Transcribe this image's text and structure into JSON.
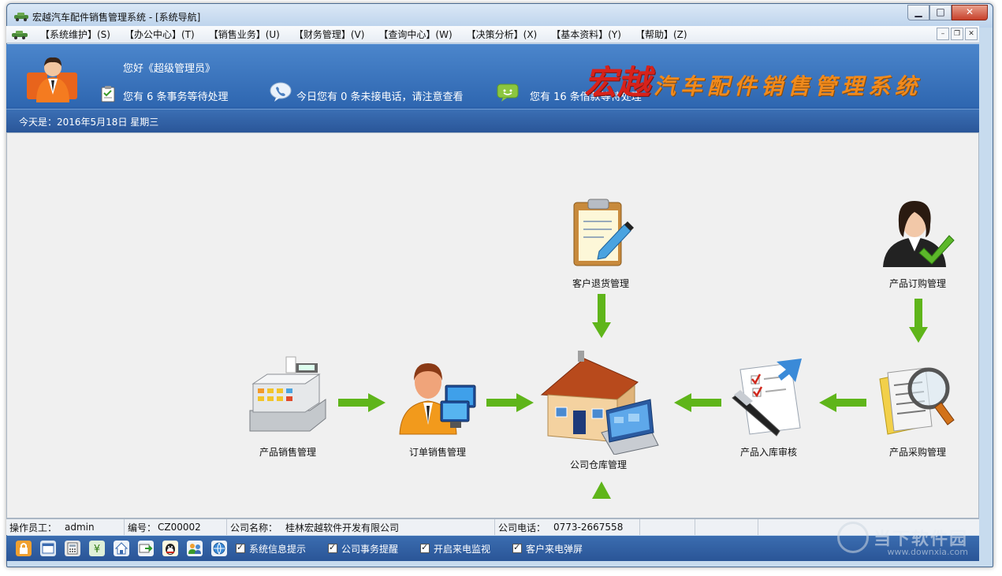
{
  "window": {
    "title": "宏越汽车配件销售管理系统 - [系统导航]"
  },
  "menubar": {
    "items": [
      "【系统维护】(S)",
      "【办公中心】(T)",
      "【销售业务】(U)",
      "【财务管理】(V)",
      "【查询中心】(W)",
      "【决策分析】(X)",
      "【基本资料】(Y)",
      "【帮助】(Z)"
    ]
  },
  "banner": {
    "greeting": "您好《超级管理员》",
    "tasks_text": "您有 6 条事务等待处理",
    "calls_text": "今日您有 0 条未接电话，请注意查看",
    "loans_text": "您有 16 条借款等待处理",
    "brand_big": "宏越",
    "brand_rest": "汽车配件销售管理系统",
    "date_text": "今天是：2016年5月18日   星期三"
  },
  "nav": {
    "customer_return": "客户退货管理",
    "product_order": "产品订购管理",
    "product_sales": "产品销售管理",
    "order_sales": "订单销售管理",
    "warehouse": "公司仓库管理",
    "stock_in_audit": "产品入库审核",
    "product_purchase": "产品采购管理"
  },
  "statusbar": {
    "operator_label": "操作员工：",
    "operator_value": "admin",
    "id_label": "编号：",
    "id_value": "CZ00002",
    "company_label": "公司名称：",
    "company_value": "桂林宏越软件开发有限公司",
    "phone_label": "公司电话：",
    "phone_value": "0773-2667558"
  },
  "toolbar": {
    "checkboxes": [
      "系统信息提示",
      "公司事务提醒",
      "开启来电监视",
      "客户来电弹屏"
    ]
  },
  "watermark": {
    "text": "当下软件园",
    "url": "www.downxia.com"
  },
  "colors": {
    "banner": "#2e66b0",
    "brand_red": "#d8221b",
    "brand_orange": "#f08a1c",
    "arrow_green": "#5fb51a"
  }
}
